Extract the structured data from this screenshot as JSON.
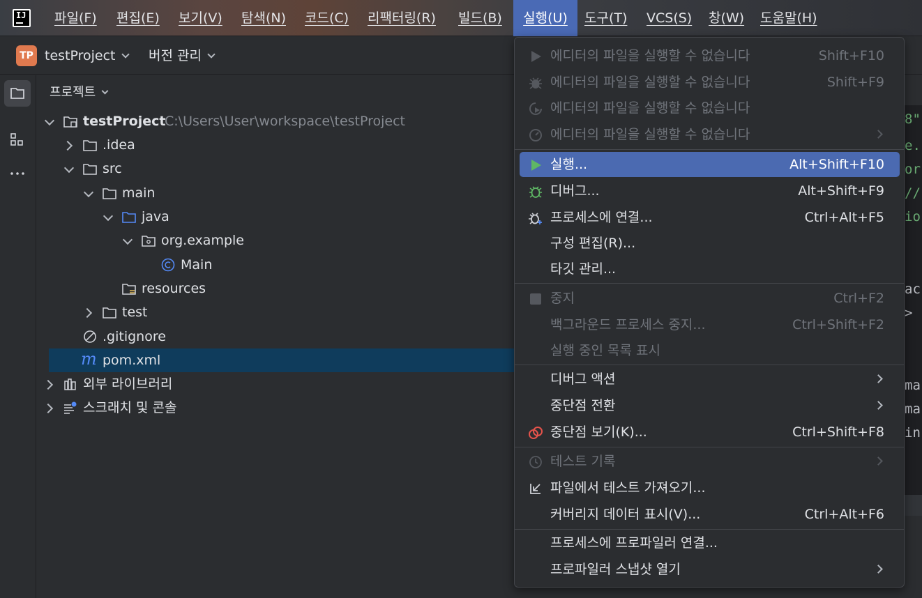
{
  "menubar": {
    "items": [
      {
        "label": "파일(F)"
      },
      {
        "label": "편집(E)"
      },
      {
        "label": "보기(V)"
      },
      {
        "label": "탐색(N)"
      },
      {
        "label": "코드(C)"
      },
      {
        "label": "리팩터링(R)"
      },
      {
        "label": "빌드(B)"
      },
      {
        "label": "실행(U)"
      },
      {
        "label": "도구(T)"
      },
      {
        "label": "VCS(S)"
      },
      {
        "label": "창(W)"
      },
      {
        "label": "도움말(H)"
      }
    ],
    "active_index": 7
  },
  "toolbar": {
    "project_badge": "TP",
    "project_name": "testProject",
    "vcs_label": "버전 관리"
  },
  "project_panel": {
    "title": "프로젝트",
    "tree": [
      {
        "label": "testProject",
        "path": "C:\\Users\\User\\workspace\\testProject"
      },
      {
        "label": ".idea"
      },
      {
        "label": "src"
      },
      {
        "label": "main"
      },
      {
        "label": "java"
      },
      {
        "label": "org.example"
      },
      {
        "label": "Main"
      },
      {
        "label": "resources"
      },
      {
        "label": "test"
      },
      {
        "label": ".gitignore"
      },
      {
        "label": "pom.xml"
      },
      {
        "label": "외부 라이브러리"
      },
      {
        "label": "스크래치 및 콘솔"
      }
    ]
  },
  "editor": {
    "code_fragments": [
      "8\"",
      "e.",
      "or",
      "//",
      "io",
      "ac",
      ">",
      "ma",
      "ma",
      "in"
    ]
  },
  "run_menu": {
    "items": [
      {
        "label": "에디터의 파일을 실행할 수 없습니다",
        "shortcut": "Shift+F10",
        "icon": "run-icon",
        "disabled": true
      },
      {
        "label": "에디터의 파일을 실행할 수 없습니다",
        "shortcut": "Shift+F9",
        "icon": "debug-icon",
        "disabled": true
      },
      {
        "label": "에디터의 파일을 실행할 수 없습니다",
        "shortcut": "",
        "icon": "coverage-icon",
        "disabled": true
      },
      {
        "label": "에디터의 파일을 실행할 수 없습니다",
        "shortcut": "",
        "icon": "profiler-icon",
        "disabled": true
      },
      {
        "label": "실행...",
        "shortcut": "Alt+Shift+F10",
        "icon": "run-icon"
      },
      {
        "label": "디버그...",
        "shortcut": "Alt+Shift+F9",
        "icon": "debug-icon"
      },
      {
        "label": "프로세스에 연결...",
        "shortcut": "Ctrl+Alt+F5",
        "icon": "attach-debugger-icon"
      },
      {
        "label": "구성 편집(R)...",
        "shortcut": ""
      },
      {
        "label": "타깃 관리...",
        "shortcut": ""
      },
      {
        "label": "중지",
        "shortcut": "Ctrl+F2",
        "icon": "stop-icon",
        "disabled": true
      },
      {
        "label": "백그라운드 프로세스 중지...",
        "shortcut": "Ctrl+Shift+F2",
        "disabled": true
      },
      {
        "label": "실행 중인 목록 표시",
        "shortcut": "",
        "disabled": true
      },
      {
        "label": "디버그 액션",
        "shortcut": ""
      },
      {
        "label": "중단점 전환",
        "shortcut": ""
      },
      {
        "label": "중단점 보기(K)...",
        "shortcut": "Ctrl+Shift+F8",
        "icon": "breakpoints-icon"
      },
      {
        "label": "테스트 기록",
        "shortcut": "",
        "icon": "history-icon",
        "disabled": true
      },
      {
        "label": "파일에서 테스트 가져오기...",
        "shortcut": "",
        "icon": "import-icon"
      },
      {
        "label": "커버리지 데이터 표시(V)...",
        "shortcut": "Ctrl+Alt+F6"
      },
      {
        "label": "프로세스에 프로파일러 연결...",
        "shortcut": ""
      },
      {
        "label": "프로파일러 스냅샷 열기",
        "shortcut": ""
      }
    ],
    "highlighted_index": 4
  },
  "colors": {
    "menu_highlight": "#4b6ab1",
    "selection": "#0f3c5c",
    "run_green": "#5fb865",
    "breakpoint_red": "#e5534b",
    "folder_blue": "#548af7"
  }
}
